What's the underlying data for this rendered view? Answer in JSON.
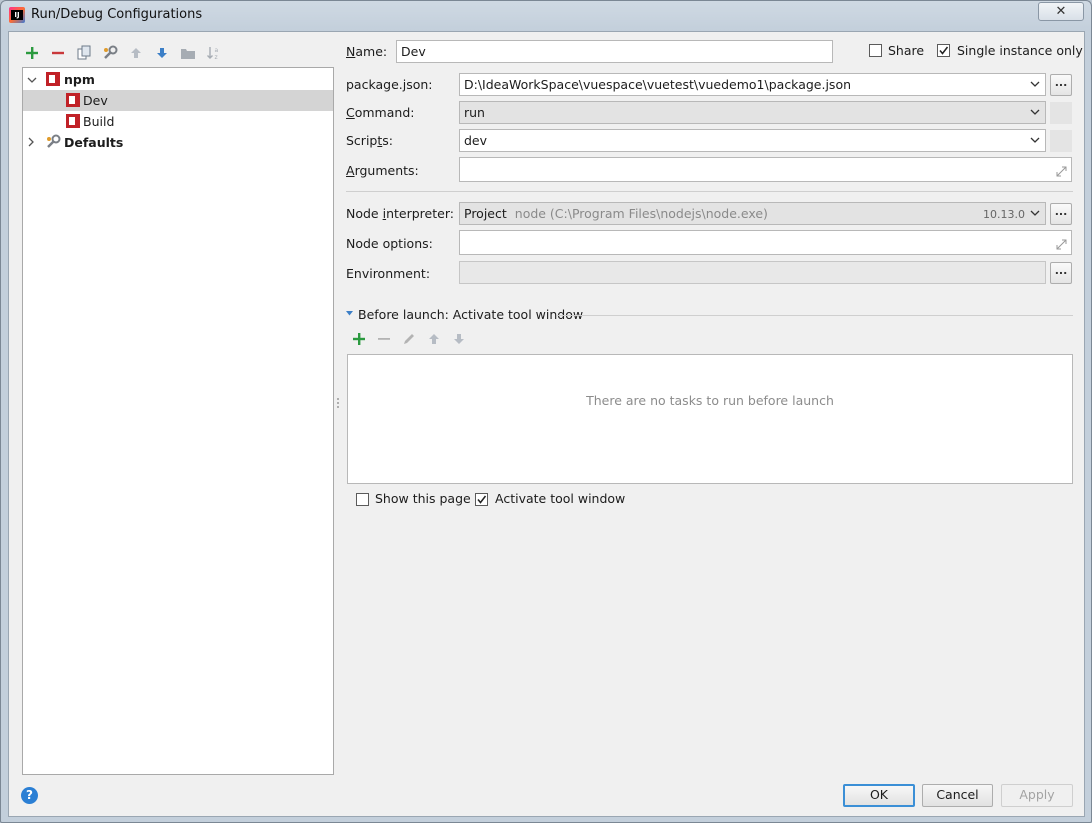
{
  "window": {
    "title": "Run/Debug Configurations",
    "close_glyph": "✕"
  },
  "tree": {
    "items": [
      {
        "label": "npm",
        "expanded": true,
        "bold": true
      },
      {
        "label": "Dev",
        "selected": true
      },
      {
        "label": "Build"
      },
      {
        "label": "Defaults",
        "bold": true,
        "expanded": false
      }
    ]
  },
  "form": {
    "name_label": "Name:",
    "name_value": "Dev",
    "share_label": "Share",
    "share_checked": false,
    "single_instance_label": "Single instance only",
    "single_instance_checked": true,
    "package_json_label": "package.json:",
    "package_json_value": "D:\\IdeaWorkSpace\\vuespace\\vuetest\\vuedemo1\\package.json",
    "command_label": "Command:",
    "command_value": "run",
    "scripts_label": "Scripts:",
    "scripts_value": "dev",
    "arguments_label": "Arguments:",
    "arguments_value": "",
    "node_interpreter_label": "Node interpreter:",
    "node_interpreter_project": "Project",
    "node_interpreter_path": "node (C:\\Program Files\\nodejs\\node.exe)",
    "node_interpreter_version": "10.13.0",
    "node_options_label": "Node options:",
    "node_options_value": "",
    "environment_label": "Environment:",
    "environment_value": "",
    "dots": "..."
  },
  "before_launch": {
    "title": "Before launch: Activate tool window",
    "empty_text": "There are no tasks to run before launch",
    "show_page_label": "Show this page",
    "show_page_checked": false,
    "activate_label": "Activate tool window",
    "activate_checked": true
  },
  "buttons": {
    "ok": "OK",
    "cancel": "Cancel",
    "apply": "Apply",
    "help": "?"
  },
  "colors": {
    "accent": "#3b8fd6",
    "add_green": "#2b9a3f",
    "remove_red": "#c9383a",
    "npm_red": "#c12127"
  }
}
